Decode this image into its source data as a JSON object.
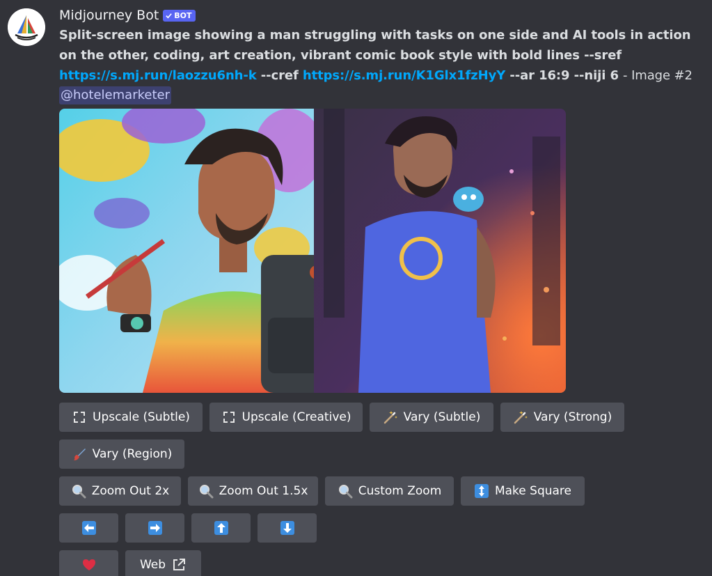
{
  "author": {
    "name": "Midjourney Bot",
    "badge": "BOT"
  },
  "message": {
    "prompt_bold": "Split-screen image showing a man struggling with tasks on one side and AI tools in action on the other, coding, art creation, vibrant comic book style with bold lines --sref",
    "sref_url": "https://s.mj.run/laozzu6nh-k",
    "cref_flag": "--cref",
    "cref_url": "https://s.mj.run/K1Glx1fzHyY",
    "params": "--ar 16:9 --niji 6",
    "suffix": "- Image #2",
    "mention": "@hotelemarketer"
  },
  "buttons": {
    "row1": [
      {
        "label": "Upscale (Subtle)",
        "icon": "upscale-icon"
      },
      {
        "label": "Upscale (Creative)",
        "icon": "upscale-icon"
      },
      {
        "label": "Vary (Subtle)",
        "icon": "magic-wand-icon"
      },
      {
        "label": "Vary (Strong)",
        "icon": "magic-wand-icon"
      }
    ],
    "row2": [
      {
        "label": "Vary (Region)",
        "icon": "paintbrush-icon"
      }
    ],
    "row3": [
      {
        "label": "Zoom Out 2x",
        "icon": "magnifier-icon"
      },
      {
        "label": "Zoom Out 1.5x",
        "icon": "magnifier-icon"
      },
      {
        "label": "Custom Zoom",
        "icon": "magnifier-icon"
      },
      {
        "label": "Make Square",
        "icon": "up-down-arrow-icon"
      }
    ],
    "row4": [
      {
        "icon": "arrow-left-icon"
      },
      {
        "icon": "arrow-right-icon"
      },
      {
        "icon": "arrow-up-icon"
      },
      {
        "icon": "arrow-down-icon"
      }
    ],
    "row5": [
      {
        "icon": "heart-icon"
      },
      {
        "label": "Web",
        "icon": "external-link-icon"
      }
    ]
  },
  "colors": {
    "background": "#323339",
    "button": "#4e5058",
    "link": "#00a8fc",
    "badge": "#5865f2"
  }
}
